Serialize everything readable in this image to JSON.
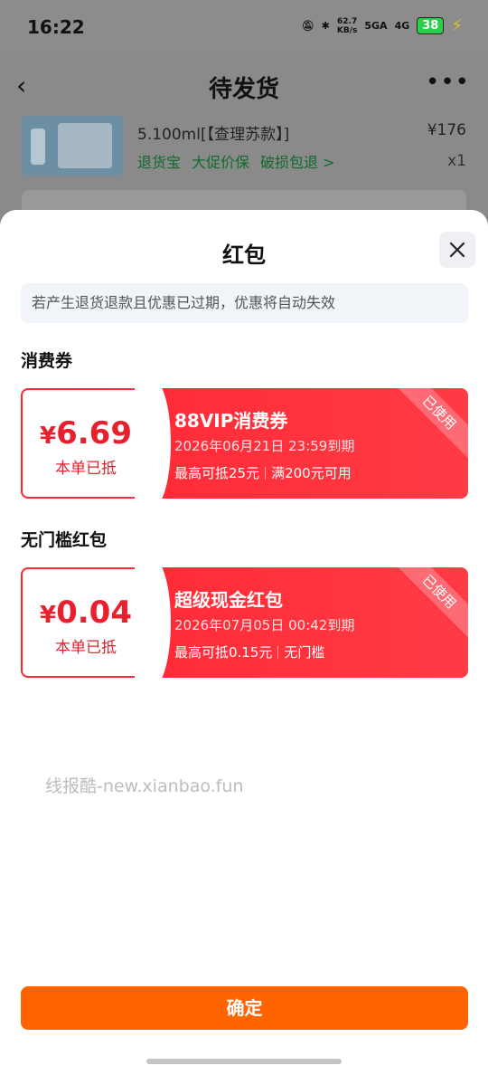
{
  "status_bar": {
    "time": "16:22",
    "net_speed_top": "62.7",
    "net_speed_bottom": "KB/s",
    "signal_1": "5GA",
    "signal_2": "4G",
    "battery": "38"
  },
  "background_page": {
    "title": "待发货",
    "product_title": "5.100ml[【查理苏款】]",
    "price": "¥176",
    "service_tags": [
      "退货宝",
      "大促价保",
      "破损包退 >"
    ],
    "quantity": "x1"
  },
  "sheet": {
    "title": "红包",
    "notice": "若产生退货退款且优惠已过期，优惠将自动失效",
    "sections": [
      {
        "label": "消费券",
        "coupon": {
          "currency": "¥",
          "amount": "6.69",
          "used_text": "本单已抵",
          "name": "88VIP消费券",
          "expire": "2026年06月21日 23:59到期",
          "rule_1": "最高可抵25元",
          "rule_2": "满200元可用",
          "badge": "已使用"
        }
      },
      {
        "label": "无门槛红包",
        "coupon": {
          "currency": "¥",
          "amount": "0.04",
          "used_text": "本单已抵",
          "name": "超级现金红包",
          "expire": "2026年07月05日 00:42到期",
          "rule_1": "最高可抵0.15元",
          "rule_2": "无门槛",
          "badge": "已使用"
        }
      }
    ],
    "watermark": "线报酷-new.xianbao.fun",
    "confirm_label": "确定"
  },
  "colors": {
    "coupon_red": "#ff2a35",
    "amount_red": "#e8202e",
    "confirm_orange": "#ff6400",
    "service_green": "#0f6b2b"
  }
}
